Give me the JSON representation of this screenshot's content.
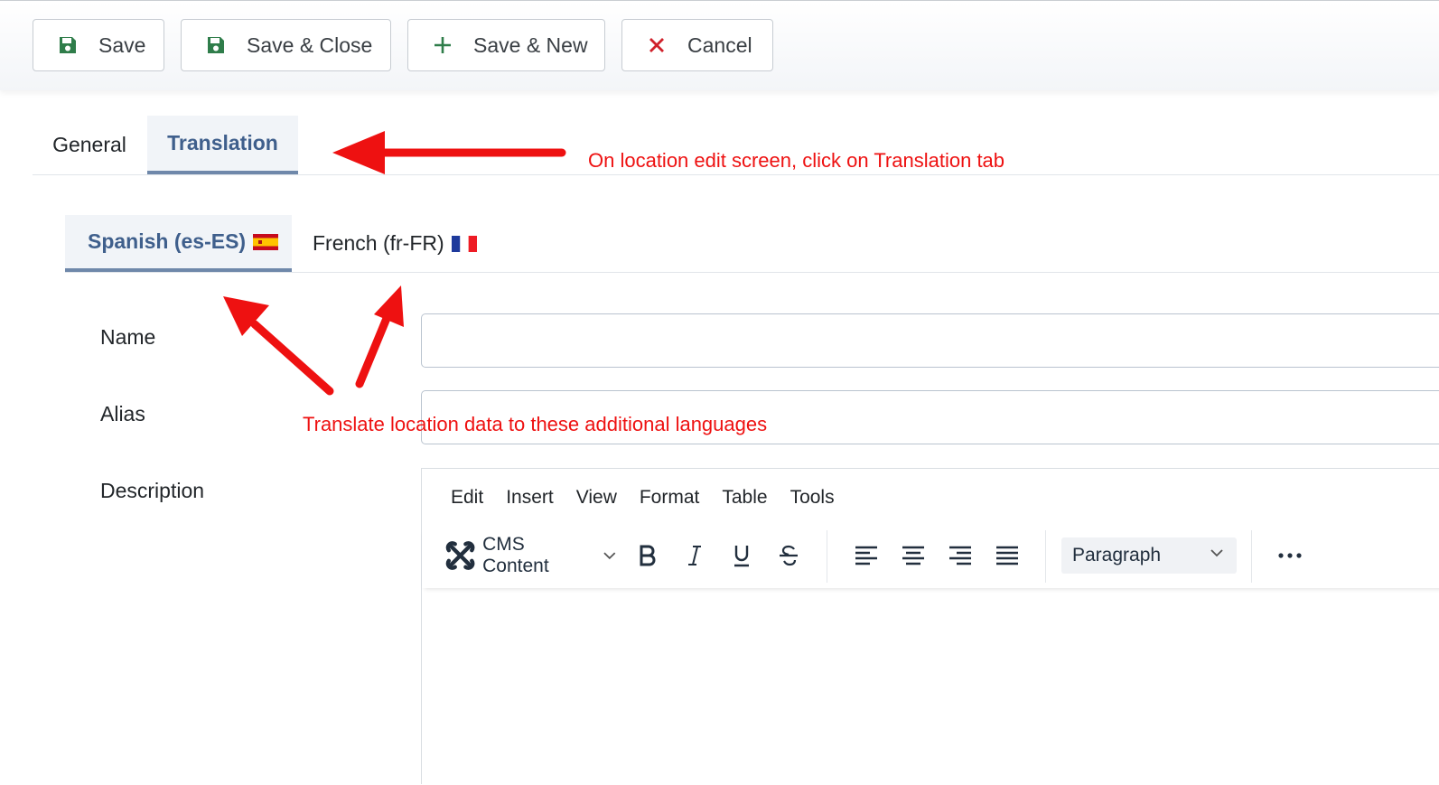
{
  "toolbar": {
    "save_label": "Save",
    "save_close_label": "Save & Close",
    "save_new_label": "Save & New",
    "cancel_label": "Cancel"
  },
  "tabs": [
    {
      "label": "General",
      "active": false
    },
    {
      "label": "Translation",
      "active": true
    }
  ],
  "language_tabs": [
    {
      "label": "Spanish (es-ES)",
      "flag": "spain-flag-icon",
      "active": true
    },
    {
      "label": "French (fr-FR)",
      "flag": "france-flag-icon",
      "active": false
    }
  ],
  "form": {
    "name_label": "Name",
    "name_value": "",
    "alias_label": "Alias",
    "alias_value": "",
    "description_label": "Description"
  },
  "editor": {
    "menu": [
      "Edit",
      "Insert",
      "View",
      "Format",
      "Table",
      "Tools"
    ],
    "cms_content_label": "CMS Content",
    "block_format": "Paragraph"
  },
  "annotations": {
    "tab_hint": "On location edit screen, click on Translation tab",
    "language_hint": "Translate location data to these additional languages"
  },
  "colors": {
    "accent": "#3f5f8c",
    "save_icon": "#2f7d4a",
    "cancel_icon": "#d0202a",
    "annotation": "#ee1111"
  }
}
